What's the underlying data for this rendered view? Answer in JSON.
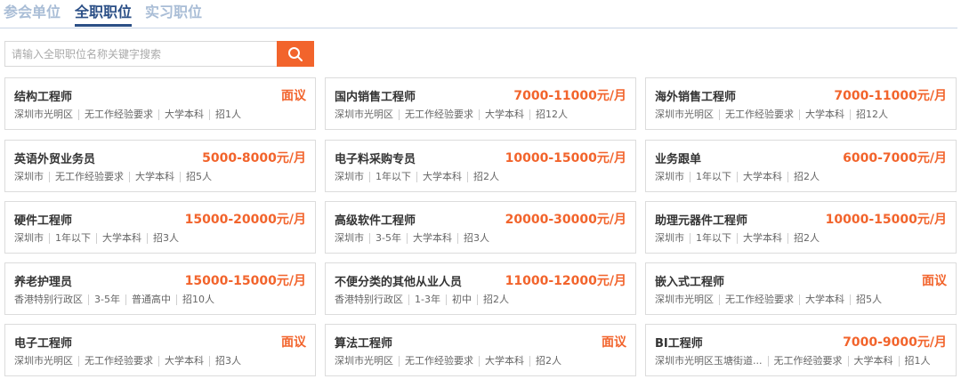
{
  "tabs": [
    {
      "label": "参会单位",
      "active": false
    },
    {
      "label": "全职职位",
      "active": true
    },
    {
      "label": "实习职位",
      "active": false
    }
  ],
  "search": {
    "placeholder": "请输入全职职位名称关键字搜索",
    "value": "",
    "button_icon": "search-icon"
  },
  "colors": {
    "accent": "#f2642c",
    "tab_active": "#2b4f86",
    "tab_inactive": "#a9bdd6"
  },
  "jobs": [
    {
      "title": "结构工程师",
      "salary": "面议",
      "tags": [
        "深圳市光明区",
        "无工作经验要求",
        "大学本科",
        "招1人"
      ]
    },
    {
      "title": "国内销售工程师",
      "salary": "7000-11000元/月",
      "tags": [
        "深圳市光明区",
        "无工作经验要求",
        "大学本科",
        "招12人"
      ]
    },
    {
      "title": "海外销售工程师",
      "salary": "7000-11000元/月",
      "tags": [
        "深圳市光明区",
        "无工作经验要求",
        "大学本科",
        "招12人"
      ]
    },
    {
      "title": "英语外贸业务员",
      "salary": "5000-8000元/月",
      "tags": [
        "深圳市",
        "无工作经验要求",
        "大学本科",
        "招5人"
      ]
    },
    {
      "title": "电子料采购专员",
      "salary": "10000-15000元/月",
      "tags": [
        "深圳市",
        "1年以下",
        "大学本科",
        "招2人"
      ]
    },
    {
      "title": "业务跟单",
      "salary": "6000-7000元/月",
      "tags": [
        "深圳市",
        "1年以下",
        "大学本科",
        "招2人"
      ]
    },
    {
      "title": "硬件工程师",
      "salary": "15000-20000元/月",
      "tags": [
        "深圳市",
        "1年以下",
        "大学本科",
        "招3人"
      ]
    },
    {
      "title": "高级软件工程师",
      "salary": "20000-30000元/月",
      "tags": [
        "深圳市",
        "3-5年",
        "大学本科",
        "招3人"
      ]
    },
    {
      "title": "助理元器件工程师",
      "salary": "10000-15000元/月",
      "tags": [
        "深圳市",
        "1年以下",
        "大学本科",
        "招2人"
      ]
    },
    {
      "title": "养老护理员",
      "salary": "15000-15000元/月",
      "tags": [
        "香港特别行政区",
        "3-5年",
        "普通高中",
        "招10人"
      ]
    },
    {
      "title": "不便分类的其他从业人员",
      "salary": "11000-12000元/月",
      "tags": [
        "香港特别行政区",
        "1-3年",
        "初中",
        "招2人"
      ]
    },
    {
      "title": "嵌入式工程师",
      "salary": "面议",
      "tags": [
        "深圳市光明区",
        "无工作经验要求",
        "大学本科",
        "招5人"
      ]
    },
    {
      "title": "电子工程师",
      "salary": "面议",
      "tags": [
        "深圳市光明区",
        "无工作经验要求",
        "大学本科",
        "招3人"
      ]
    },
    {
      "title": "算法工程师",
      "salary": "面议",
      "tags": [
        "深圳市光明区",
        "无工作经验要求",
        "大学本科",
        "招2人"
      ]
    },
    {
      "title": "BI工程师",
      "salary": "7000-9000元/月",
      "tags": [
        "深圳市光明区玉塘街道...",
        "无工作经验要求",
        "大学本科",
        "招1人"
      ]
    }
  ]
}
